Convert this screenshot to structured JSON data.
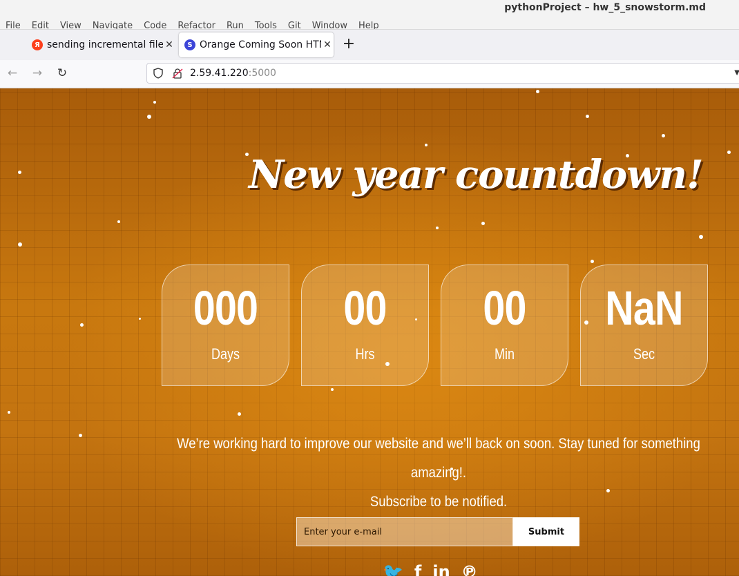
{
  "os": {
    "title": "pythonProject – hw_5_snowstorm.md"
  },
  "ide_menu": [
    "File",
    "Edit",
    "View",
    "Navigate",
    "Code",
    "Refactor",
    "Run",
    "Tools",
    "Git",
    "Window",
    "Help"
  ],
  "tabs": [
    {
      "label": "sending incremental file l",
      "icon": "yandex-icon",
      "close": "✕"
    },
    {
      "label": "Orange Coming Soon HTM",
      "icon": "site-s-icon",
      "close": "✕"
    }
  ],
  "new_tab_label": "+",
  "nav": {
    "url_host": "2.59.41.220",
    "url_port": ":5000"
  },
  "page": {
    "heading": "New year countdown!",
    "countdown": [
      {
        "value": "000",
        "label": "Days"
      },
      {
        "value": "00",
        "label": "Hrs"
      },
      {
        "value": "00",
        "label": "Min"
      },
      {
        "value": "NaN",
        "label": "Sec"
      }
    ],
    "message_line1": "We’re working hard to improve our website and we’ll back on soon. Stay tuned for something amazing!.",
    "message_line2": "Subscribe to be notified.",
    "email_placeholder": "Enter your e-mail",
    "submit_label": "Submit",
    "social": [
      "twitter-icon",
      "facebook-icon",
      "linkedin-icon",
      "pinterest-icon"
    ]
  },
  "colors": {
    "accent_orange": "#c0700c",
    "heading_shadow": "#5a2a00",
    "yandex_red": "#fc3f1d",
    "site_icon_blue": "#3c45d8"
  }
}
